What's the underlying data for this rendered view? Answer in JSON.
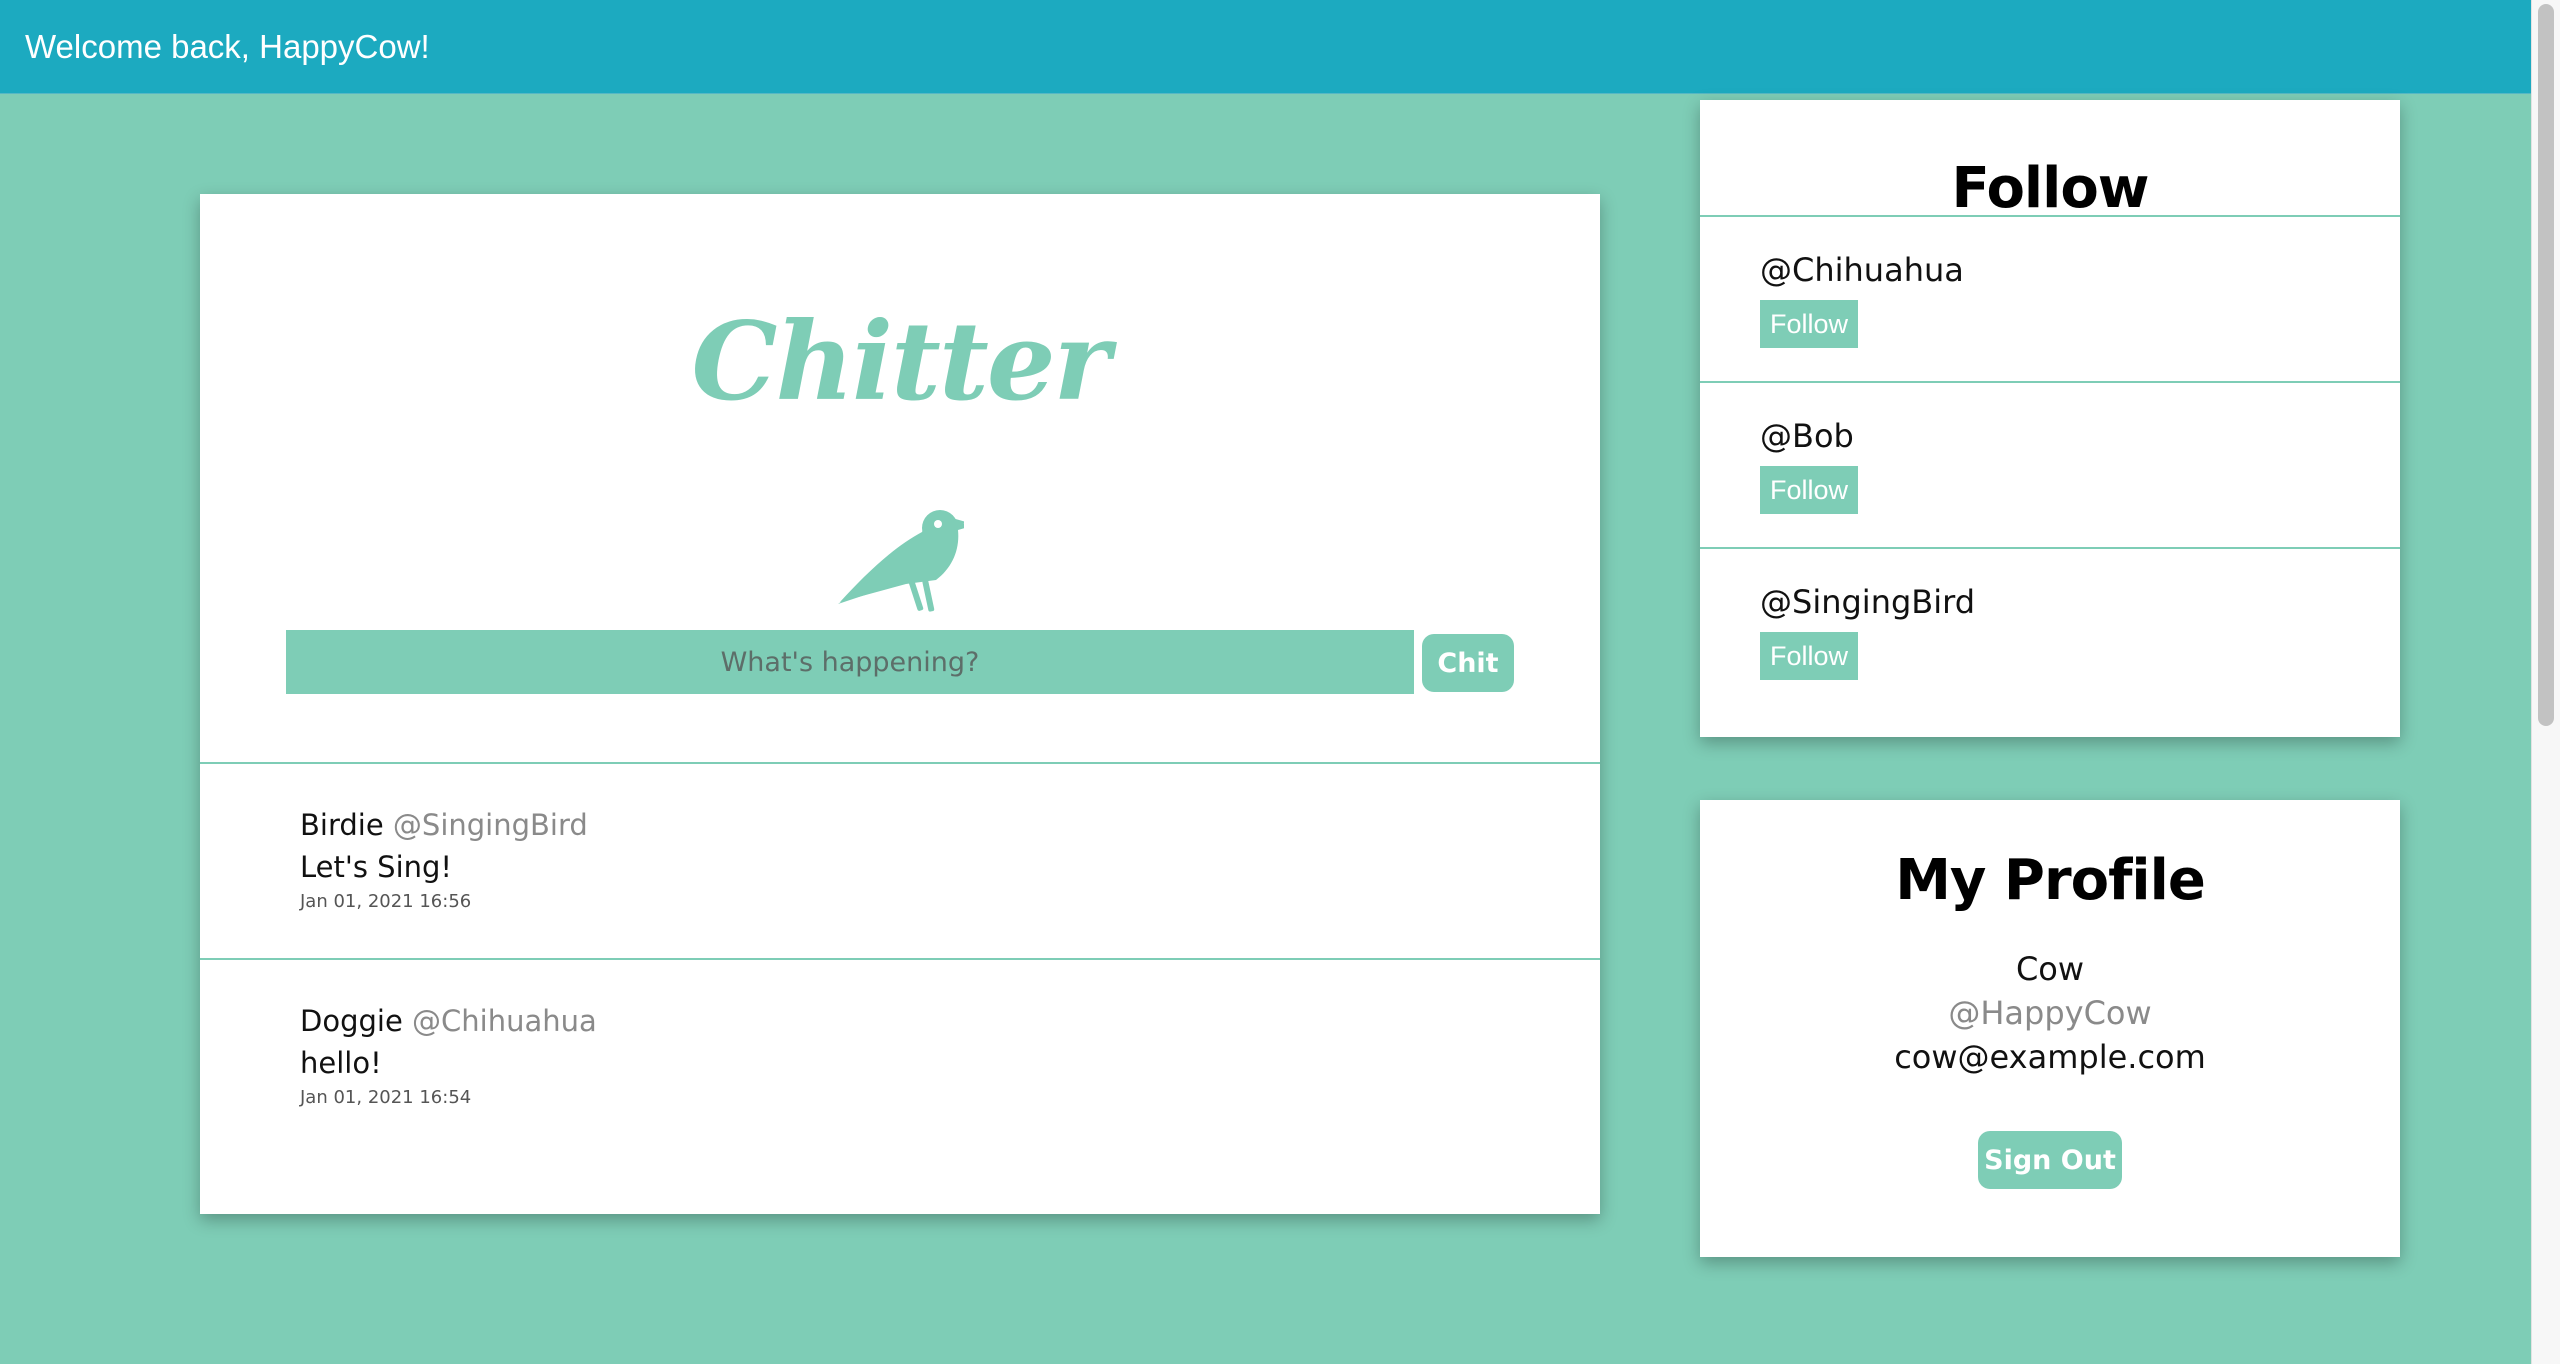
{
  "header": {
    "welcome_text": "Welcome back, HappyCow!"
  },
  "feed": {
    "logo_text": "Chitter",
    "logo_icon": "crow-icon",
    "compose": {
      "placeholder": "What's happening?",
      "value": "",
      "submit_label": "Chit"
    },
    "posts": [
      {
        "name": "Birdie",
        "handle": "@SingingBird",
        "body": "Let's Sing!",
        "time": "Jan 01, 2021 16:56"
      },
      {
        "name": "Doggie",
        "handle": "@Chihuahua",
        "body": "hello!",
        "time": "Jan 01, 2021 16:54"
      }
    ]
  },
  "follow": {
    "title": "Follow",
    "users": [
      {
        "handle": "@Chihuahua",
        "button_label": "Follow"
      },
      {
        "handle": "@Bob",
        "button_label": "Follow"
      },
      {
        "handle": "@SingingBird",
        "button_label": "Follow"
      }
    ]
  },
  "profile": {
    "title": "My Profile",
    "name": "Cow",
    "handle": "@HappyCow",
    "email": "cow@example.com",
    "signout_label": "Sign Out"
  },
  "colors": {
    "accent": "#7ecdb6",
    "header_bar": "#1caac0",
    "page_background": "#7ecdb6",
    "card_background": "#ffffff",
    "muted_text": "#8a8a8a"
  }
}
